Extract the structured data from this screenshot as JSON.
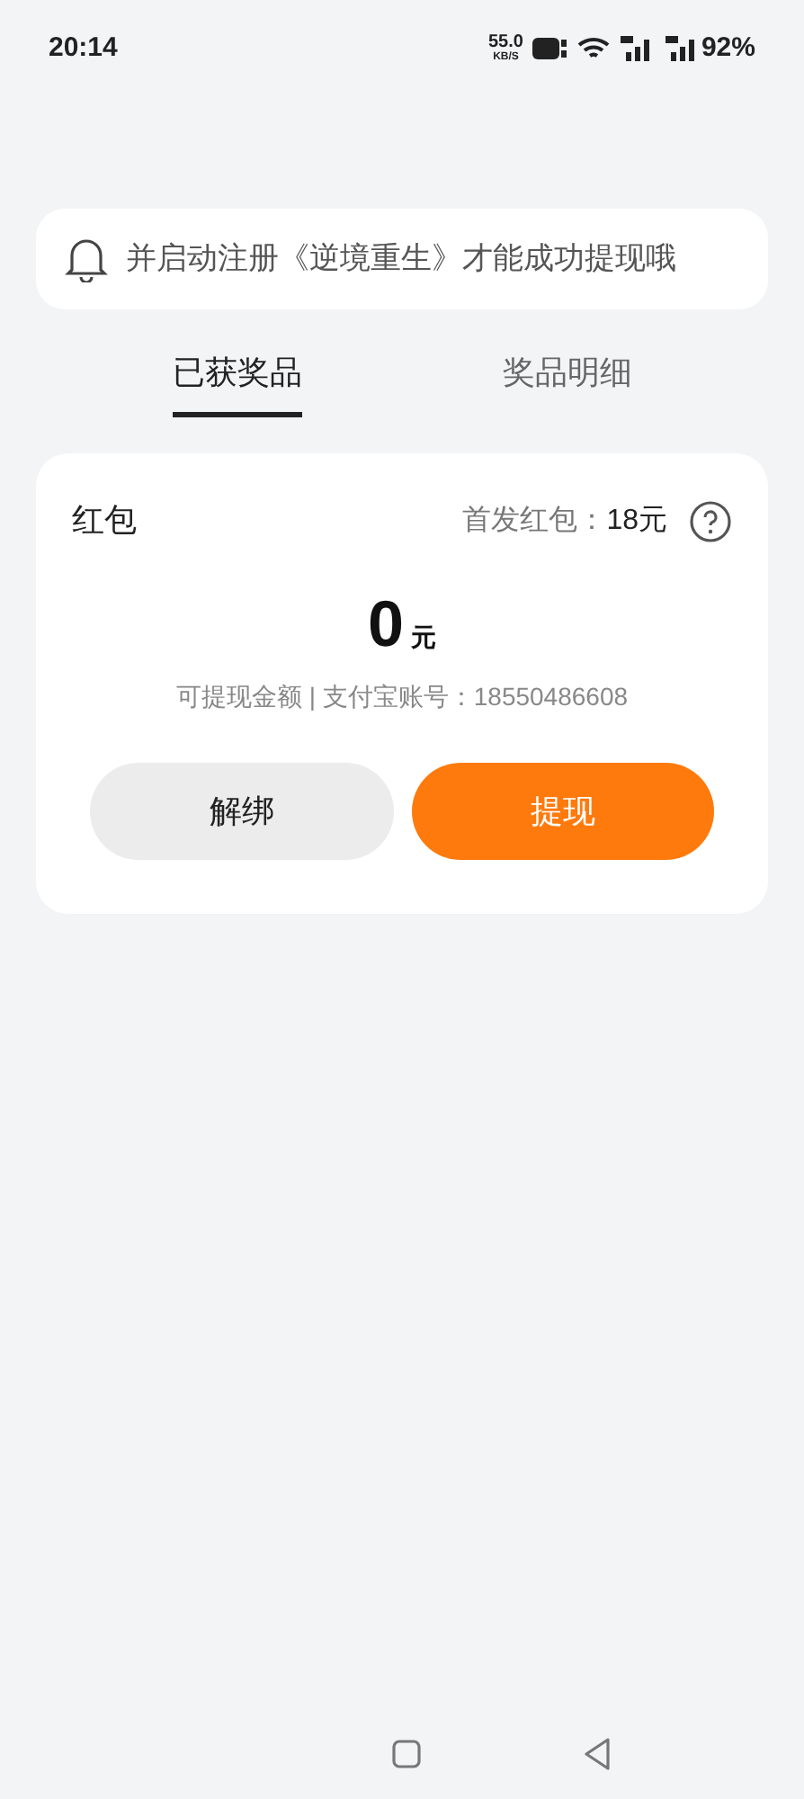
{
  "status_bar": {
    "time": "20:14",
    "speed": "55.0",
    "speed_unit": "KB/S",
    "battery": "92%"
  },
  "notice": {
    "text": "并启动注册《逆境重生》才能成功提现哦"
  },
  "tabs": [
    {
      "label": "已获奖品",
      "selected": true
    },
    {
      "label": "奖品明细",
      "selected": false
    }
  ],
  "card": {
    "title": "红包",
    "bonus_label": "首发红包：",
    "bonus_value": "18元",
    "amount": "0",
    "amount_unit": "元",
    "caption": "可提现金额 | 支付宝账号：18550486608",
    "buttons": [
      {
        "label": "解绑",
        "kind": "secondary"
      },
      {
        "label": "提现",
        "kind": "primary"
      }
    ]
  }
}
